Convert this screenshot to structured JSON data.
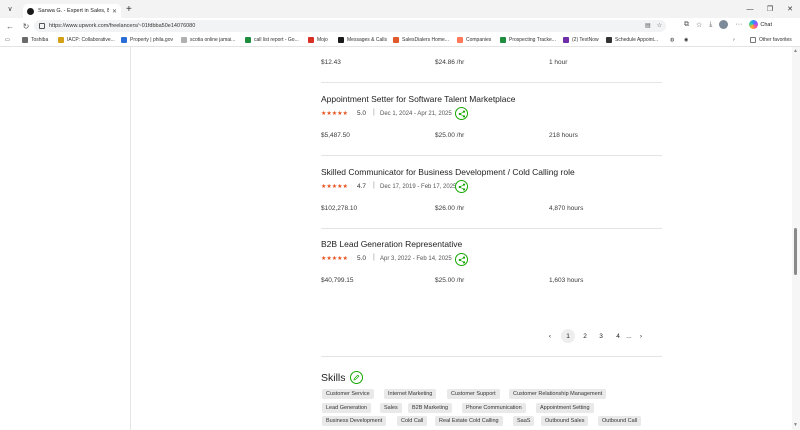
{
  "browser": {
    "tab_title": "Sanwa G. - Expert in Sales, Busine:",
    "url": "https://www.upwork.com/freelancers/~01fdbba50e14076080",
    "chat_label": "Chat",
    "bookmarks": [
      {
        "label": "Toshiba",
        "color": "#6b6b6b"
      },
      {
        "label": "IACP: Collaborative...",
        "color": "#d4a017"
      },
      {
        "label": "Property | phila.gov",
        "color": "#2b6fd6"
      },
      {
        "label": "scotia online jamai...",
        "color": "#b0b0b0"
      },
      {
        "label": "call list report - Go...",
        "color": "#1e8e3e"
      },
      {
        "label": "Mojo",
        "color": "#d93025"
      },
      {
        "label": "Messages & Calls",
        "color": "#1a1a1a"
      },
      {
        "label": "SalesDialers Home...",
        "color": "#e05a2b"
      },
      {
        "label": "Companies",
        "color": "#ff7a59"
      },
      {
        "label": "Prospecting Tracke...",
        "color": "#1e8e3e"
      },
      {
        "label": "(2) TextNow",
        "color": "#6f2da8"
      },
      {
        "label": "Schedule Appoint...",
        "color": "#333333"
      }
    ],
    "other_favorites": "Other favorites"
  },
  "top_row": {
    "earned": "$12.43",
    "rate": "$24.86 /hr",
    "hours": "1 hour"
  },
  "jobs": [
    {
      "title": "Appointment Setter for Software Talent Marketplace",
      "rating": "5.0",
      "stars": "★★★★★",
      "dates": "Dec 1, 2024 - Apr 21, 2025",
      "earned": "$5,487.50",
      "rate": "$25.00 /hr",
      "hours": "218 hours"
    },
    {
      "title": "Skilled Communicator for Business Development / Cold Calling role",
      "rating": "4.7",
      "stars": "★★★★★",
      "dates": "Dec 17, 2019 - Feb 17, 2025",
      "earned": "$102,278.10",
      "rate": "$26.00 /hr",
      "hours": "4,870 hours"
    },
    {
      "title": "B2B Lead Generation Representative",
      "rating": "5.0",
      "stars": "★★★★★",
      "dates": "Apr 3, 2022 - Feb 14, 2025",
      "earned": "$40,799.15",
      "rate": "$25.00 /hr",
      "hours": "1,603 hours"
    }
  ],
  "pagination": {
    "prev": "‹",
    "pages": [
      "1",
      "2",
      "3",
      "4"
    ],
    "ellipsis": "...",
    "next": "›",
    "current": "1"
  },
  "skills": {
    "title": "Skills",
    "items": [
      "Customer Service",
      "Internet Marketing",
      "Customer Support",
      "Customer Relationship Management",
      "Lead Generation",
      "Sales",
      "B2B Marketing",
      "Phone Communication",
      "Appointment Setting",
      "Business Development",
      "Cold Call",
      "Real Estate Cold Calling",
      "SaaS",
      "Outbound Sales",
      "Outbound Call"
    ]
  },
  "colors": {
    "accent": "#14a800",
    "star": "#e8511c"
  },
  "icons": [
    "tab-menu-icon",
    "new-tab-icon",
    "back-icon",
    "refresh-icon",
    "share-icon",
    "edit-icon"
  ]
}
